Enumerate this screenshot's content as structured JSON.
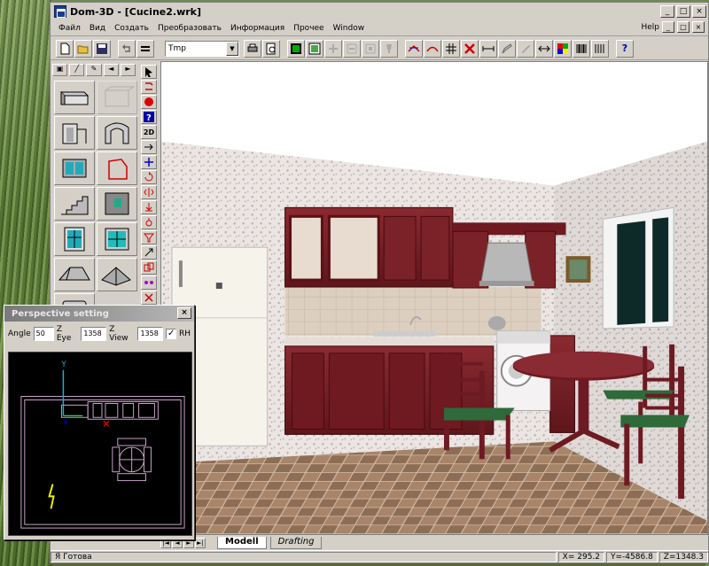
{
  "window": {
    "title": "Dom-3D - [Cucine2.wrk]",
    "min": "_",
    "max": "□",
    "close": "×"
  },
  "menu": {
    "items": [
      "Файл",
      "Вид",
      "Создать",
      "Преобразовать",
      "Информация",
      "Прочее",
      "Window"
    ],
    "help": "Help",
    "right_min": "_",
    "right_max": "□",
    "right_close": "×"
  },
  "toolbar": {
    "layer_value": "Tmp",
    "help": "?"
  },
  "palette": {
    "tab_left": "◄",
    "tab_right": "►"
  },
  "vtools": {
    "view_2d": "2D"
  },
  "view_tabs": [
    "Modell",
    "Drafting"
  ],
  "dialog": {
    "title": "Perspective setting",
    "close": "×",
    "angle_label": "Angle",
    "angle_value": "50",
    "zeye_label": "Z Eye",
    "zeye_value": "1358",
    "zview_label": "Z View",
    "zview_value": "1358",
    "rh_label": "RH",
    "rh_checked": "✓"
  },
  "status": {
    "ready": "Я Готова",
    "x": "X= 295.2",
    "y": "Y=-4586.8",
    "z": "Z=1348.3"
  },
  "colors": {
    "cabinet": "#7a1f24",
    "floor": "#9c7a5e",
    "wall": "#ece6e6",
    "chrome_face": "#d4d0c8",
    "plan_lines": "#c8a0c8"
  }
}
